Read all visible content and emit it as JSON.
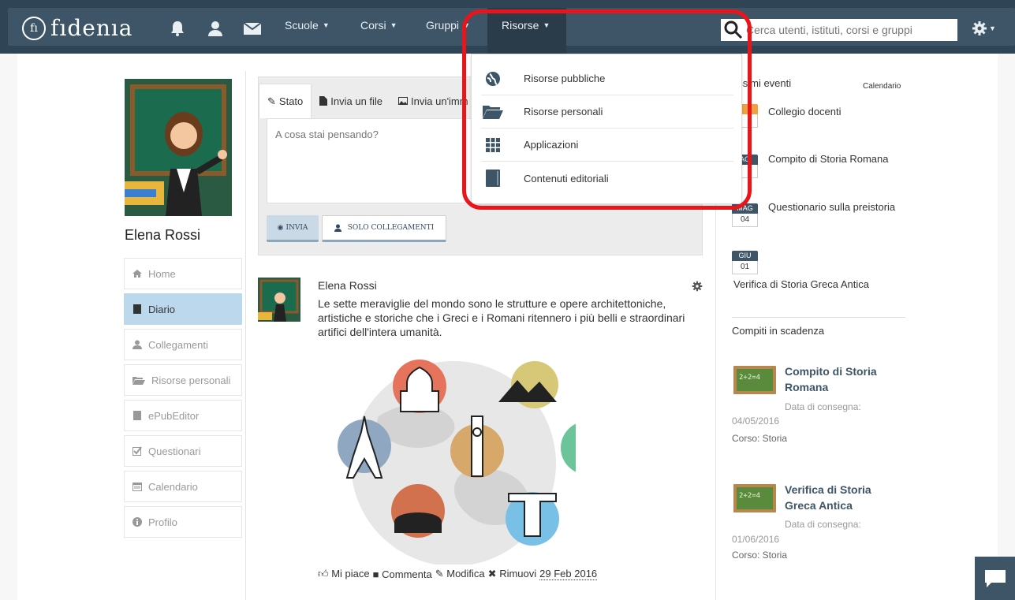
{
  "navbar": {
    "brand_mark": "fı",
    "brand_name": "fıdenıa",
    "menus": [
      {
        "label": "Scuole"
      },
      {
        "label": "Corsi"
      },
      {
        "label": "Gruppi"
      },
      {
        "label": "Risorse"
      }
    ],
    "search_placeholder": "Cerca utenti, istituti, corsi e gruppi"
  },
  "dropdown": {
    "items": [
      {
        "label": "Risorse pubbliche",
        "icon": "globe-icon"
      },
      {
        "label": "Risorse personali",
        "icon": "folder-open-icon"
      },
      {
        "label": "Applicazioni",
        "icon": "grid-icon"
      },
      {
        "label": "Contenuti editoriali",
        "icon": "book-icon"
      }
    ]
  },
  "profile": {
    "name": "Elena Rossi"
  },
  "sidebar": {
    "items": [
      {
        "label": "Home",
        "icon": "home-icon"
      },
      {
        "label": "Diario",
        "icon": "book-icon",
        "active": true
      },
      {
        "label": "Collegamenti",
        "icon": "user-icon"
      },
      {
        "label": "Risorse personali",
        "icon": "folder-open-icon"
      },
      {
        "label": "ePubEditor",
        "icon": "book-icon"
      },
      {
        "label": "Questionari",
        "icon": "checkbox-icon"
      },
      {
        "label": "Calendario",
        "icon": "calendar-icon"
      },
      {
        "label": "Profilo",
        "icon": "info-icon"
      }
    ]
  },
  "composer": {
    "tabs": [
      "Stato",
      "Invia un file",
      "Invia un'imm"
    ],
    "placeholder": "A cosa stai pensando?",
    "send_label": "INVIA",
    "only_label": "SOLO COLLEGAMENTI"
  },
  "post": {
    "author": "Elena Rossi",
    "text": "Le sette meraviglie del mondo sono le strutture e opere architettoniche, artistiche e storiche che i Greci e i Romani ritennero i più belli e straordinari artifici dell'intera umanità.",
    "actions": {
      "like": "Mi piace",
      "comment": "Commenta",
      "edit": "Modifica",
      "remove": "Rimuovi",
      "date": "29 Feb 2016"
    }
  },
  "events": {
    "title": "ossimi eventi",
    "calendar_link": "Calendario",
    "items": [
      {
        "month": "",
        "day": "",
        "label": "Collegio docenti",
        "accent": "#f0a040"
      },
      {
        "month": "AG",
        "day": "",
        "label": "Compito di Storia Romana"
      },
      {
        "month": "MAG",
        "day": "04",
        "label": "Questionario sulla preistoria"
      },
      {
        "month": "GIU",
        "day": "01",
        "label": "Verifica di Storia Greca Antica"
      }
    ]
  },
  "tasks": {
    "title": "Compiti in scadenza",
    "items": [
      {
        "board": "2+2=4",
        "title": "Compito di Storia Romana",
        "due_label": "Data di consegna:",
        "due": "04/05/2016",
        "course": "Corso: Storia"
      },
      {
        "board": "2+2=4",
        "title": "Verifica di Storia Greca Antica",
        "due_label": "Data di consegna:",
        "due": "01/06/2016",
        "course": "Corso: Storia"
      }
    ]
  },
  "colors": {
    "navbar": "#3d5566",
    "active_sidebar": "#bcd8ec",
    "highlight": "#e8151b"
  }
}
